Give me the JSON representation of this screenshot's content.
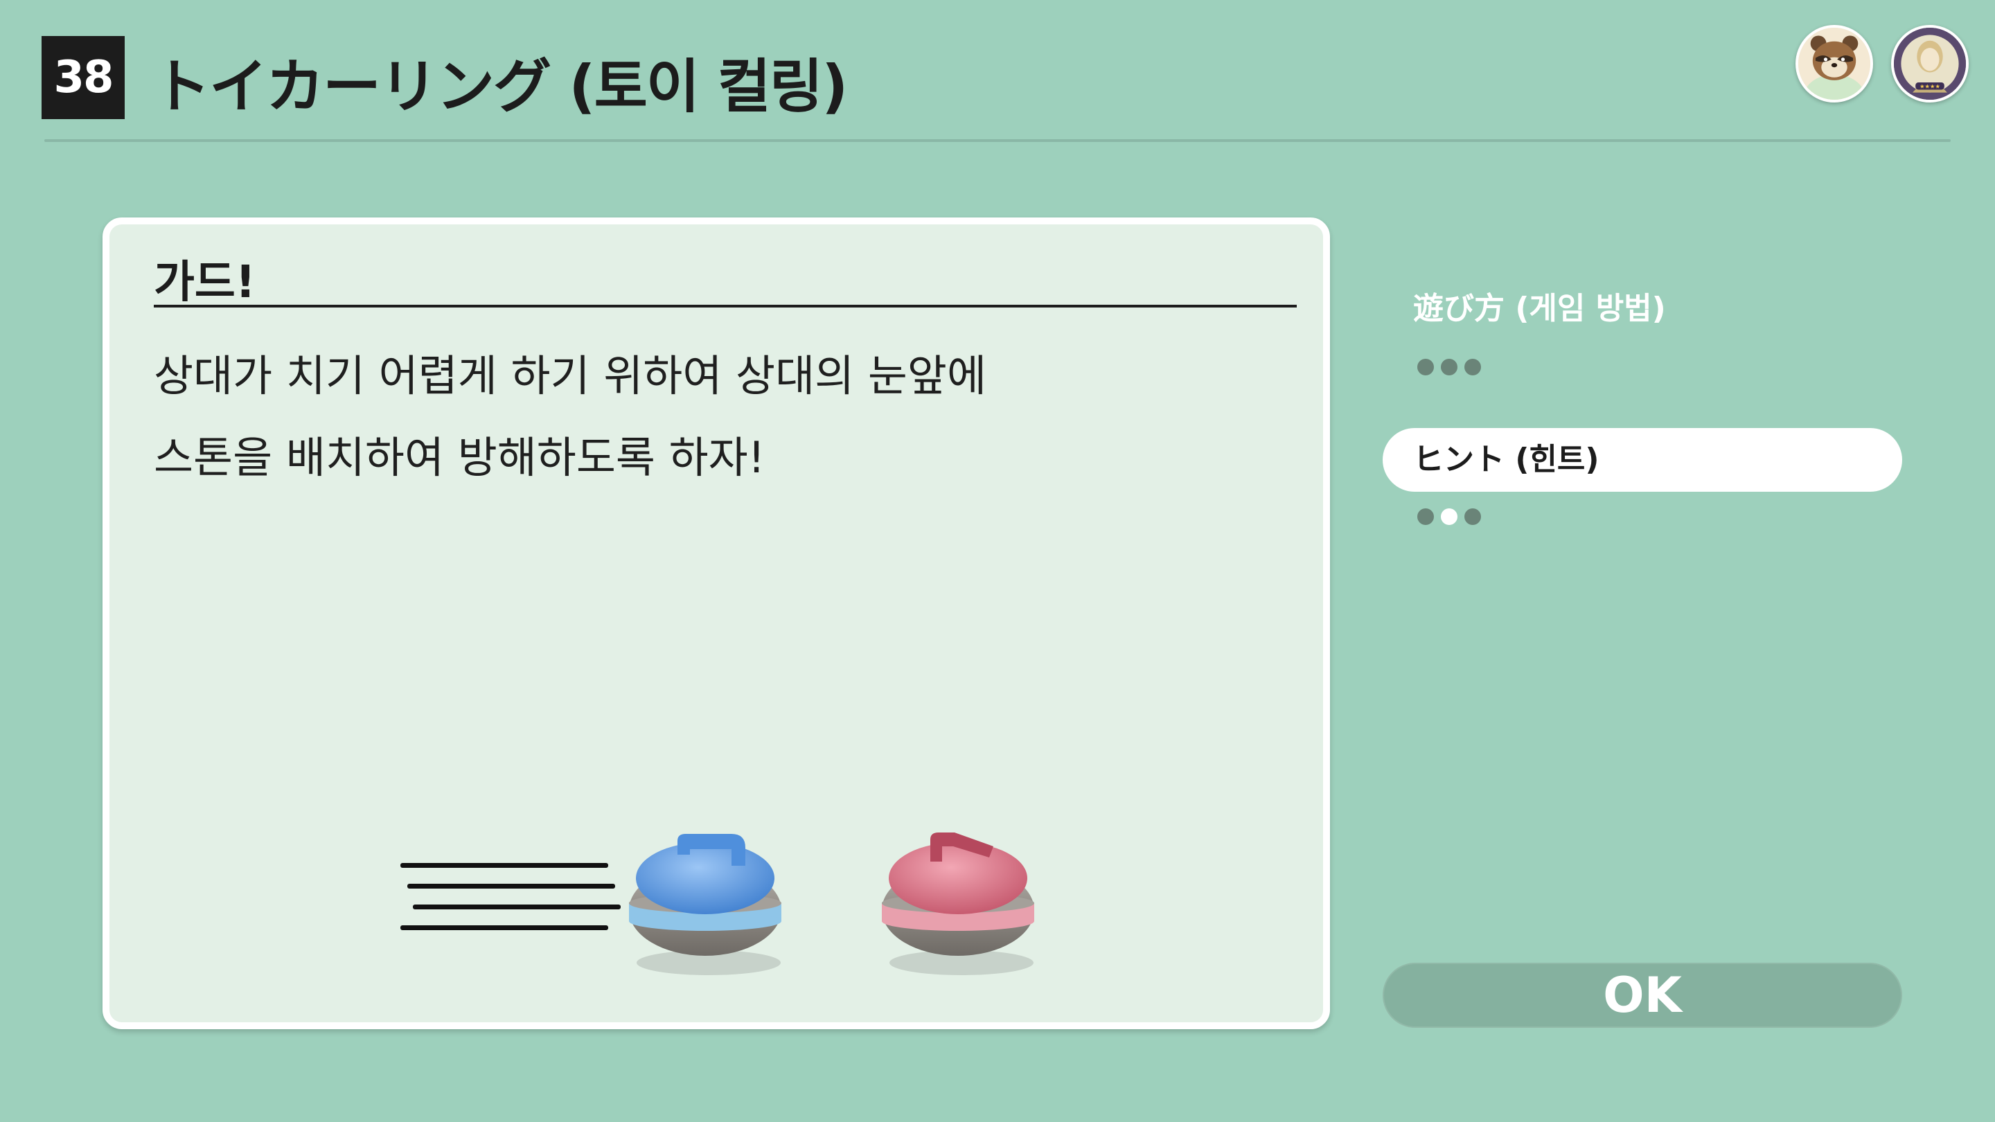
{
  "header": {
    "number": "38",
    "title": "トイカーリング (토이 컬링)"
  },
  "avatars": [
    {
      "name": "raccoon-character-avatar"
    },
    {
      "name": "player-avatar"
    }
  ],
  "card": {
    "heading": "가드!",
    "lines": [
      "상대가 치기 어렵게 하기 위하여 상대의 눈앞에",
      "스톤을 배치하여 방해하도록 하자!"
    ]
  },
  "menu": {
    "items": [
      {
        "label": "遊び方 (게임 방법)",
        "selected": false,
        "dots": 3,
        "active_dot": null
      },
      {
        "label": "ヒント (힌트)",
        "selected": true,
        "dots": 3,
        "active_dot": 1
      }
    ]
  },
  "ok_label": "OK",
  "colors": {
    "background": "#9dd0bc",
    "card": "#e3f0e6",
    "blue_stone": "#5b9ae0",
    "red_stone": "#d66b7c",
    "ok_button": "#85b19f"
  }
}
